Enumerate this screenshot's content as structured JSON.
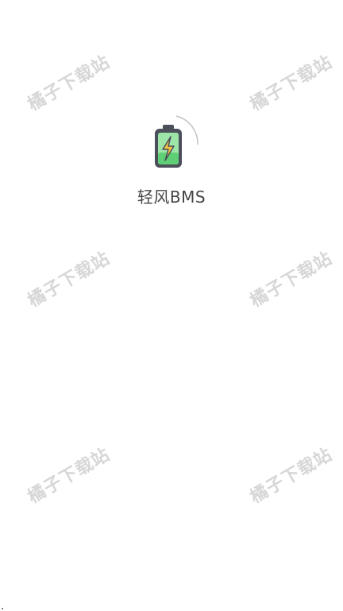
{
  "app": {
    "name": "轻风BMS"
  },
  "watermarks": [
    "橘子下载站",
    "橘子下载站",
    "橘子下载站",
    "橘子下载站",
    "橘子下载站",
    "橘子下载站"
  ],
  "colors": {
    "background": "#ffffff",
    "battery_body": "#4a4f5a",
    "battery_fill": "#78d98a",
    "bolt": "#f6c344",
    "watermark": "#d7d7d7",
    "text": "#444444"
  },
  "icons": {
    "logo": "battery-charging-icon",
    "loading": "loading-arc-icon"
  }
}
